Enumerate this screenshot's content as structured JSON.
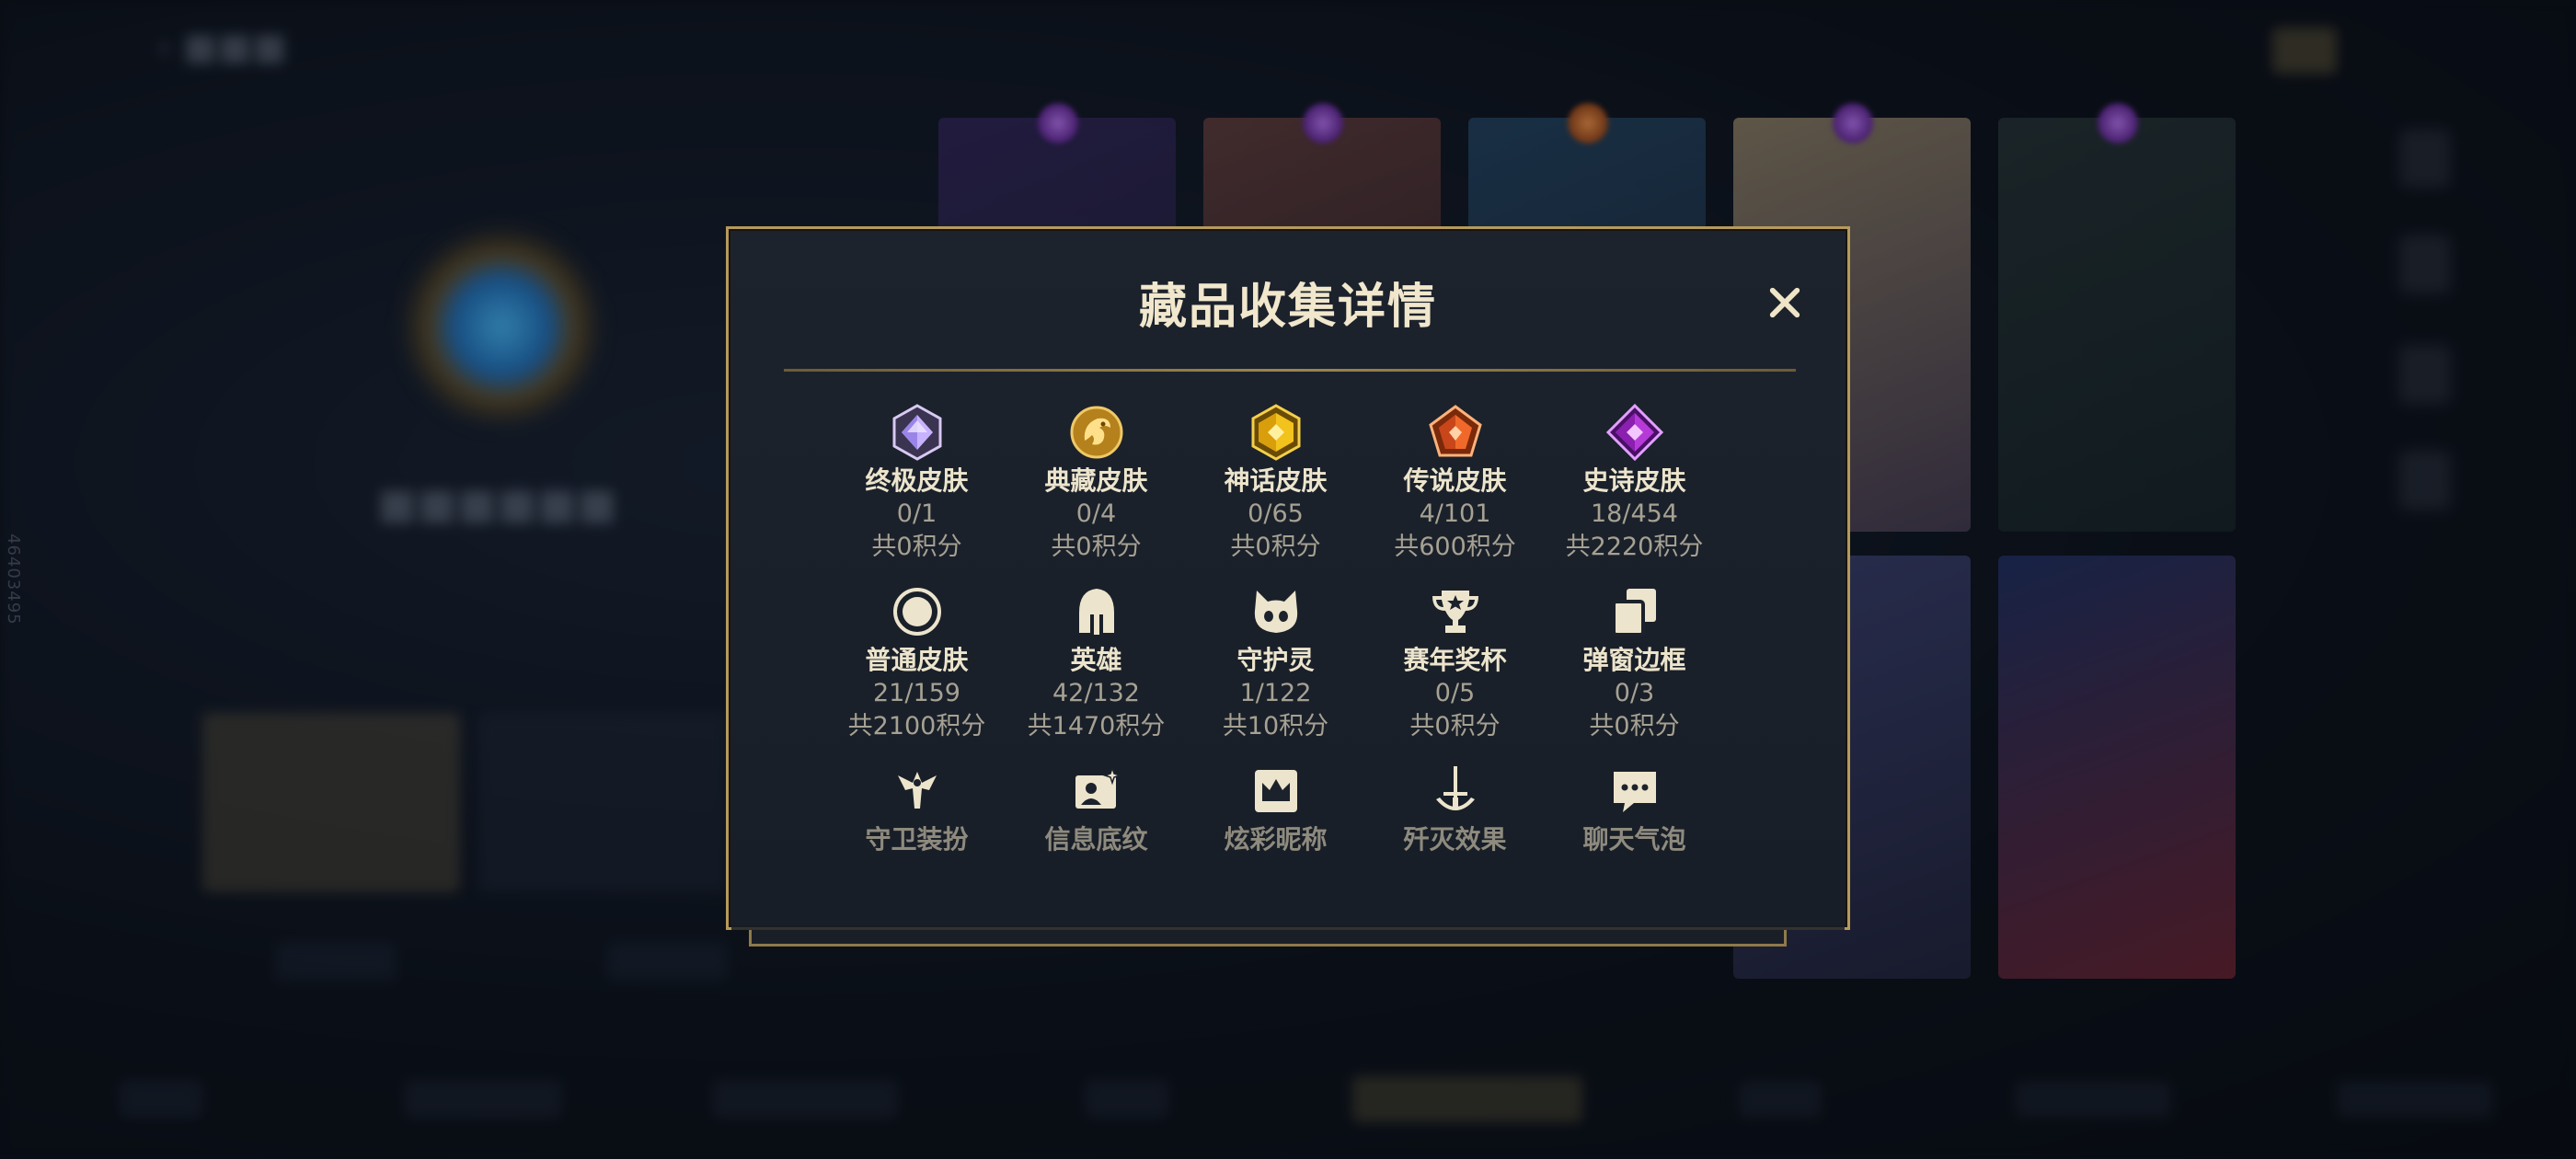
{
  "background": {
    "side_label": "46403495"
  },
  "modal": {
    "title": "藏品收集详情",
    "close_label": "✕",
    "categories": [
      {
        "name": "终极皮肤",
        "count": "0/1",
        "points": "共0积分",
        "icon": "ultimate-gem-icon",
        "color": "#b89cff"
      },
      {
        "name": "典藏皮肤",
        "count": "0/4",
        "points": "共0积分",
        "icon": "dragon-emblem-icon",
        "color": "#e0a92e"
      },
      {
        "name": "神话皮肤",
        "count": "0/65",
        "points": "共0积分",
        "icon": "mythic-gem-icon",
        "color": "#f2c21d"
      },
      {
        "name": "传说皮肤",
        "count": "4/101",
        "points": "共600积分",
        "icon": "legendary-gem-icon",
        "color": "#f0692a"
      },
      {
        "name": "史诗皮肤",
        "count": "18/454",
        "points": "共2220积分",
        "icon": "epic-gem-icon",
        "color": "#b63ad8"
      },
      {
        "name": "普通皮肤",
        "count": "21/159",
        "points": "共2100积分",
        "icon": "circle-icon",
        "color": "#e8e2cf"
      },
      {
        "name": "英雄",
        "count": "42/132",
        "points": "共1470积分",
        "icon": "helmet-icon",
        "color": "#e8e2cf"
      },
      {
        "name": "守护灵",
        "count": "1/122",
        "points": "共10积分",
        "icon": "guardian-face-icon",
        "color": "#e8e2cf"
      },
      {
        "name": "赛年奖杯",
        "count": "0/5",
        "points": "共0积分",
        "icon": "trophy-icon",
        "color": "#e8e2cf"
      },
      {
        "name": "弹窗边框",
        "count": "0/3",
        "points": "共0积分",
        "icon": "frames-icon",
        "color": "#e8e2cf"
      },
      {
        "name": "守卫装扮",
        "icon": "ward-icon",
        "color": "#e8e2cf"
      },
      {
        "name": "信息底纹",
        "icon": "card-sparkle-icon",
        "color": "#e8e2cf"
      },
      {
        "name": "炫彩昵称",
        "icon": "crown-icon",
        "color": "#e8e2cf"
      },
      {
        "name": "歼灭效果",
        "icon": "sword-icon",
        "color": "#e8e2cf"
      },
      {
        "name": "聊天气泡",
        "icon": "chat-bubble-icon",
        "color": "#e8e2cf"
      }
    ]
  },
  "colors": {
    "gold_border": "#b59a5c",
    "modal_bg": "#1b222c",
    "title": "#f1e7cc",
    "subtext": "#a6a193"
  }
}
